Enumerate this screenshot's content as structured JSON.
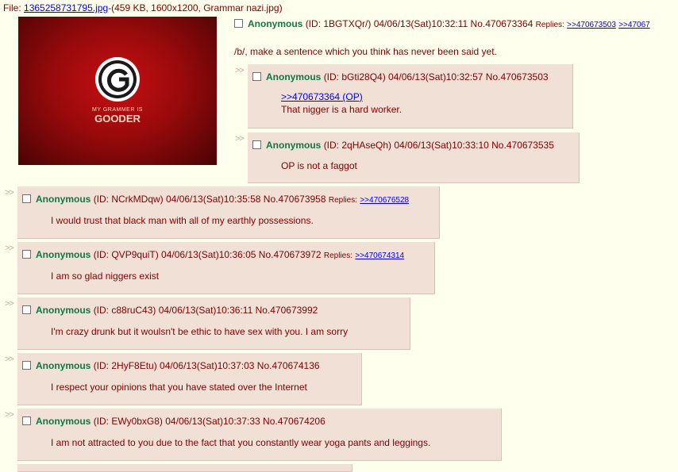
{
  "file": {
    "prefix": "File: ",
    "link": "1365258731795.jpg",
    "meta": "-(459 KB, 1600x1200, Grammar nazi.jpg)"
  },
  "image": {
    "caption_line1": "MY GRAMMER IS",
    "caption_line2": "GOODER"
  },
  "op": {
    "name": "Anonymous",
    "info": "(ID: 1BGTXQr/) 04/06/13(Sat)10:32:11 No.470673364",
    "replies_label": "Replies:",
    "replies": [
      ">>470673503",
      ">>47067"
    ],
    "comment": "/b/, make a sentence which you think has never been said yet."
  },
  "arrows": ">>",
  "posts": [
    {
      "name": "Anonymous",
      "info": "(ID: bGti28Q4) 04/06/13(Sat)10:32:57 No.470673503",
      "quote": ">>470673364 (OP)",
      "comment": "That nigger is a hard worker.",
      "replies_label": "",
      "reply": ""
    },
    {
      "name": "Anonymous",
      "info": "(ID: 2qHAseQh) 04/06/13(Sat)10:33:10 No.470673535",
      "quote": "",
      "comment": "OP is not a faggot",
      "replies_label": "",
      "reply": ""
    },
    {
      "name": "Anonymous",
      "info": "(ID: NCrkMDqw) 04/06/13(Sat)10:35:58 No.470673958",
      "quote": "",
      "comment": "I would trust that black man with all of my earthly possessions.",
      "replies_label": "Replies:",
      "reply": ">>470676528"
    },
    {
      "name": "Anonymous",
      "info": "(ID: QVP9quiT) 04/06/13(Sat)10:36:05 No.470673972",
      "quote": "",
      "comment": "I am so glad niggers exist",
      "replies_label": "Replies:",
      "reply": ">>470674314"
    },
    {
      "name": "Anonymous",
      "info": "(ID: c88ruC43) 04/06/13(Sat)10:36:11 No.470673992",
      "quote": "",
      "comment": "I'm crazy drunk but it woulsn't be ethic to have sex with you. I am sorry",
      "replies_label": "",
      "reply": ""
    },
    {
      "name": "Anonymous",
      "info": "(ID: 2HyF8Etu) 04/06/13(Sat)10:37:03 No.470674136",
      "quote": "",
      "comment": "I respect your opinions that you have stated over the Internet",
      "replies_label": "",
      "reply": ""
    },
    {
      "name": "Anonymous",
      "info": "(ID: EWy0bxG8) 04/06/13(Sat)10:37:33 No.470674206",
      "quote": "",
      "comment": "I am not attracted to you due to the fact that you constantly wear yoga pants and leggings.",
      "replies_label": "",
      "reply": ""
    }
  ]
}
